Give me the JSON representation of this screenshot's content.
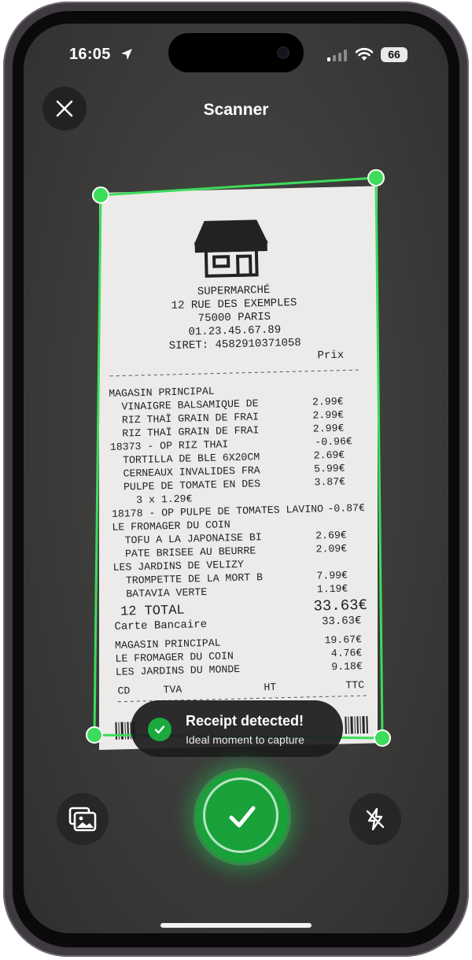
{
  "status_bar": {
    "time": "16:05",
    "battery": "66"
  },
  "header": {
    "title": "Scanner"
  },
  "receipt": {
    "store_name": "SUPERMARCHÉ",
    "address_line1": "12 RUE DES EXEMPLES",
    "address_line2": "75000 PARIS",
    "phone": "01.23.45.67.89",
    "siret": "SIRET: 4582910371058",
    "price_header": "Prix",
    "rows": [
      {
        "label": "MAGASIN PRINCIPAL",
        "price": ""
      },
      {
        "label": "  VINAIGRE BALSAMIQUE DE",
        "price": "2.99€"
      },
      {
        "label": "  RIZ THAÏ GRAIN DE FRAI",
        "price": "2.99€"
      },
      {
        "label": "  RIZ THAÏ GRAIN DE FRAI",
        "price": "2.99€"
      },
      {
        "label": "18373 - OP RIZ THAI",
        "price": "-0.96€"
      },
      {
        "label": "  TORTILLA DE BLE 6X20CM",
        "price": "2.69€"
      },
      {
        "label": "  CERNEAUX INVALIDES FRA",
        "price": "5.99€"
      },
      {
        "label": "  PULPE DE TOMATE EN DES",
        "price": "3.87€"
      },
      {
        "label": "    3 x 1.29€",
        "price": ""
      },
      {
        "label": "18178 - OP PULPE DE TOMATES LAVINO",
        "price": "-0.87€"
      },
      {
        "label": "LE FROMAGER DU COIN",
        "price": ""
      },
      {
        "label": "  TOFU A LA JAPONAISE BI",
        "price": "2.69€"
      },
      {
        "label": "  PATE BRISEE AU BEURRE",
        "price": "2.09€"
      },
      {
        "label": "LES JARDINS DE VELIZY",
        "price": ""
      },
      {
        "label": "  TROMPETTE DE LA MORT B",
        "price": "7.99€"
      },
      {
        "label": "  BATAVIA VERTE",
        "price": "1.19€"
      }
    ],
    "total_label": "12 TOTAL",
    "total_value": "33.63€",
    "payment_label": "Carte Bancaire",
    "payment_value": "33.63€",
    "summary": [
      {
        "label": "MAGASIN PRINCIPAL",
        "price": "19.67€"
      },
      {
        "label": "LE FROMAGER DU COIN",
        "price": "4.76€"
      },
      {
        "label": "LES JARDINS DU MONDE",
        "price": "9.18€"
      }
    ],
    "tax_headers": [
      "CD",
      "TVA",
      "HT",
      "TTC"
    ]
  },
  "toast": {
    "title": "Receipt detected!",
    "subtitle": "Ideal moment to capture"
  },
  "controls": {
    "gallery_icon": "gallery-icon",
    "capture_icon": "checkmark-icon",
    "flash_icon": "flash-off-icon"
  },
  "colors": {
    "accent": "#1fbf4a",
    "capture": "#19a23a",
    "frame": "#3ddc5b"
  }
}
